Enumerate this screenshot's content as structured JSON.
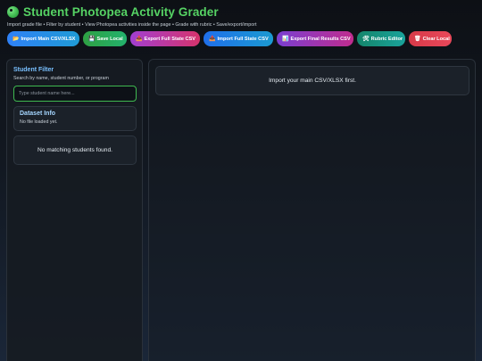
{
  "header": {
    "title": "Student Photopea Activity Grader",
    "subtitle": "Import grade file • Filter by student • View Photopea activities inside the page • Grade with rubric • Save/export/import"
  },
  "toolbar": {
    "import_main": {
      "icon": "📂",
      "label": "Import Main CSV/XLSX"
    },
    "save_local": {
      "icon": "💾",
      "label": "Save Local"
    },
    "export_full": {
      "icon": "📤",
      "label": "Export Full State CSV"
    },
    "import_full": {
      "icon": "📥",
      "label": "Import Full State CSV"
    },
    "export_final": {
      "icon": "📊",
      "label": "Export Final Results CSV"
    },
    "rubric_editor": {
      "icon": "🛠",
      "label": "Rubric Editor"
    },
    "clear_local": {
      "icon": "🗑",
      "label": "Clear Local"
    }
  },
  "filter": {
    "title": "Student Filter",
    "subtitle": "Search by name, student number, or program",
    "placeholder": "Type student name here...",
    "value": ""
  },
  "dataset": {
    "title": "Dataset Info",
    "status": "No file loaded yet."
  },
  "student_list": {
    "empty_message": "No matching students found."
  },
  "main": {
    "notice": "Import your main CSV/XLSX first."
  },
  "colors": {
    "title_green": "#56d364",
    "panel_heading_blue": "#79c0ff",
    "search_focus_border": "#3fb950"
  }
}
